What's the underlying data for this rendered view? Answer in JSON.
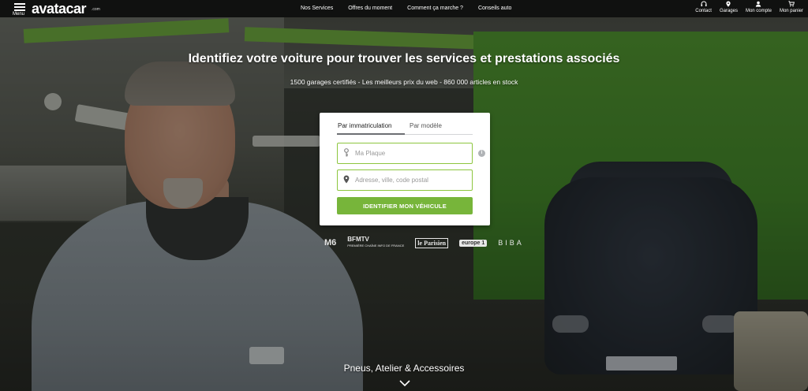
{
  "header": {
    "menu_label": "Menu",
    "logo": "avatacar",
    "logo_suffix": ".com",
    "nav": [
      {
        "label": "Nos Services"
      },
      {
        "label": "Offres du moment"
      },
      {
        "label": "Comment ça marche ?"
      },
      {
        "label": "Conseils auto"
      }
    ],
    "actions": [
      {
        "label": "Contact",
        "icon": "headset-icon"
      },
      {
        "label": "Garages",
        "icon": "location-pin-icon"
      },
      {
        "label": "Mon compte",
        "icon": "user-icon"
      },
      {
        "label": "Mon panier",
        "icon": "cart-icon"
      }
    ]
  },
  "hero": {
    "headline": "Identifiez votre voiture pour trouver les services et prestations associés",
    "subline": "1500 garages certifiés - Les meilleurs prix du web - 860 000 articles en stock"
  },
  "search": {
    "tabs": [
      {
        "label": "Par immatriculation",
        "active": true
      },
      {
        "label": "Par modèle",
        "active": false
      }
    ],
    "plate_placeholder": "Ma Plaque",
    "address_placeholder": "Adresse, ville, code postal",
    "submit_label": "IDENTIFIER MON VÉHICULE",
    "accent_color": "#77b53a",
    "border_color": "#8dc63f"
  },
  "press": [
    {
      "name": "M6"
    },
    {
      "name": "BFMTV",
      "tagline": "PREMIÈRE CHAÎNE INFO DE FRANCE"
    },
    {
      "name": "le Parisien"
    },
    {
      "name": "europe 1"
    },
    {
      "name": "BIBA"
    }
  ],
  "bottom": {
    "title": "Pneus, Atelier & Accessoires"
  }
}
